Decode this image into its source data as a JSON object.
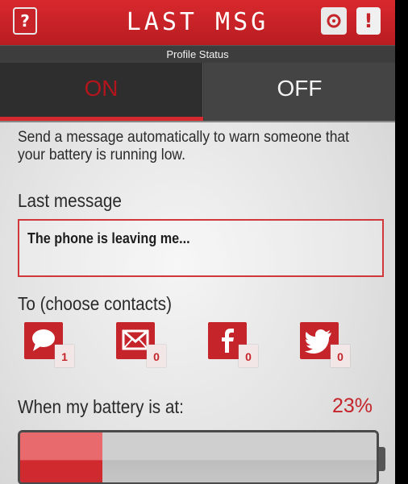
{
  "header": {
    "title": "LAST MSG",
    "help_label": "?",
    "alert_label": "!",
    "subtitle": "Profile Status"
  },
  "toggle": {
    "on_label": "ON",
    "off_label": "OFF",
    "selected": "ON"
  },
  "description": "Send a message automatically to warn someone that your battery is running low.",
  "last_message": {
    "label": "Last message",
    "value": "The phone is leaving me..."
  },
  "contacts": {
    "label": "To (choose contacts)",
    "channels": [
      {
        "icon": "sms-icon",
        "count": "1"
      },
      {
        "icon": "email-icon",
        "count": "0"
      },
      {
        "icon": "facebook-icon",
        "count": "0"
      },
      {
        "icon": "twitter-icon",
        "count": "0"
      }
    ]
  },
  "battery": {
    "label": "When my battery is at:",
    "percent_label": "23%",
    "level": 0.23
  },
  "colors": {
    "accent": "#c4242a",
    "dark": "#3a3a3a"
  }
}
